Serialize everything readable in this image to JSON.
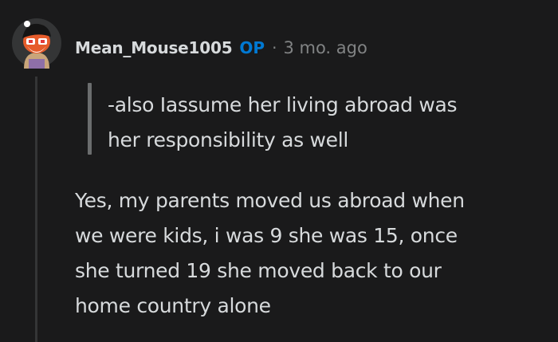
{
  "comment": {
    "username": "Mean_Mouse1005",
    "op_badge": "OP",
    "separator": "·",
    "timestamp": "3 mo. ago",
    "avatar_icon": "snoo-avatar-icon",
    "quote_lines": [
      "-also Iassume her living abroad was",
      "her responsibility as well"
    ],
    "body_lines": [
      "Yes, my parents moved us abroad when",
      "we were kids, i was 9 she was 15, once",
      "she turned 19 she moved back to our",
      "home country alone"
    ]
  },
  "colors": {
    "background": "#1a1a1b",
    "text": "#d7dadc",
    "meta": "#818384",
    "op": "#0079d3",
    "quote_bar": "#6b6d6e",
    "thread_line": "#343536"
  }
}
